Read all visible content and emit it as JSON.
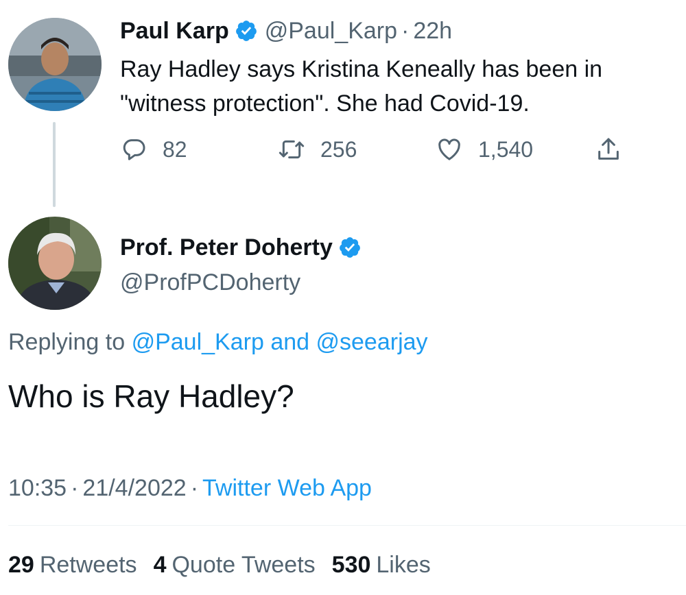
{
  "parent_tweet": {
    "author_name": "Paul Karp",
    "handle": "@Paul_Karp",
    "separator": "·",
    "time_ago": "22h",
    "text_line1": "Ray Hadley says Kristina Keneally has been in",
    "text_line2": "\"witness protection\". She had Covid-19.",
    "actions": {
      "reply_count": "82",
      "retweet_count": "256",
      "like_count": "1,540"
    }
  },
  "reply_tweet": {
    "author_name": "Prof. Peter Doherty",
    "handle": "@ProfPCDoherty",
    "replying_prefix": "Replying to",
    "replying_user1": "@Paul_Karp",
    "replying_and": "and",
    "replying_user2": "@seearjay",
    "text": "Who is Ray Hadley?",
    "time": "10:35",
    "separator": "·",
    "date": "21/4/2022",
    "source": "Twitter Web App"
  },
  "stats": {
    "retweets_count": "29",
    "retweets_label": "Retweets",
    "quotes_count": "4",
    "quotes_label": "Quote Tweets",
    "likes_count": "530",
    "likes_label": "Likes"
  },
  "colors": {
    "text_primary": "#0f1419",
    "text_secondary": "#536471",
    "accent_blue": "#1d9bf0",
    "verified_badge": "#1d9bf0",
    "thread_line": "#cfd9de"
  },
  "icons": [
    "verified-badge-icon",
    "reply-icon",
    "retweet-icon",
    "like-icon",
    "share-icon"
  ]
}
